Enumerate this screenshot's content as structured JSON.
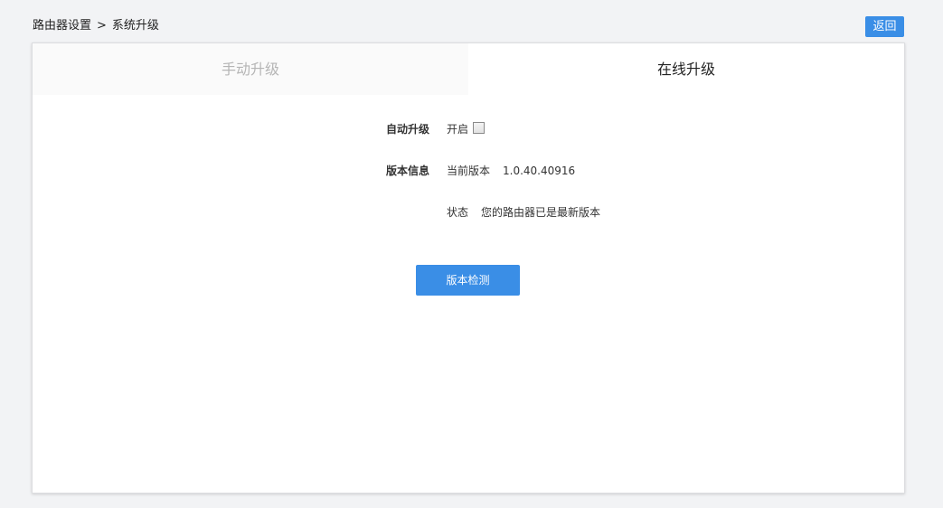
{
  "breadcrumb": {
    "parent": "路由器设置",
    "separator": ">",
    "current": "系统升级"
  },
  "back_button": {
    "label": "返回"
  },
  "tabs": [
    {
      "label": "手动升级",
      "active": false
    },
    {
      "label": "在线升级",
      "active": true
    }
  ],
  "auto_upgrade": {
    "label": "自动升级",
    "option_label": "开启",
    "checked": false
  },
  "version_info": {
    "label": "版本信息",
    "current_version_label": "当前版本",
    "current_version_value": "1.0.40.40916",
    "status_label": "状态",
    "status_value": "您的路由器已是最新版本"
  },
  "check_button": {
    "label": "版本检测"
  },
  "colors": {
    "accent": "#3a8ee6",
    "background": "#f2f3f5",
    "inactive_tab_text": "#b5b5b5"
  }
}
